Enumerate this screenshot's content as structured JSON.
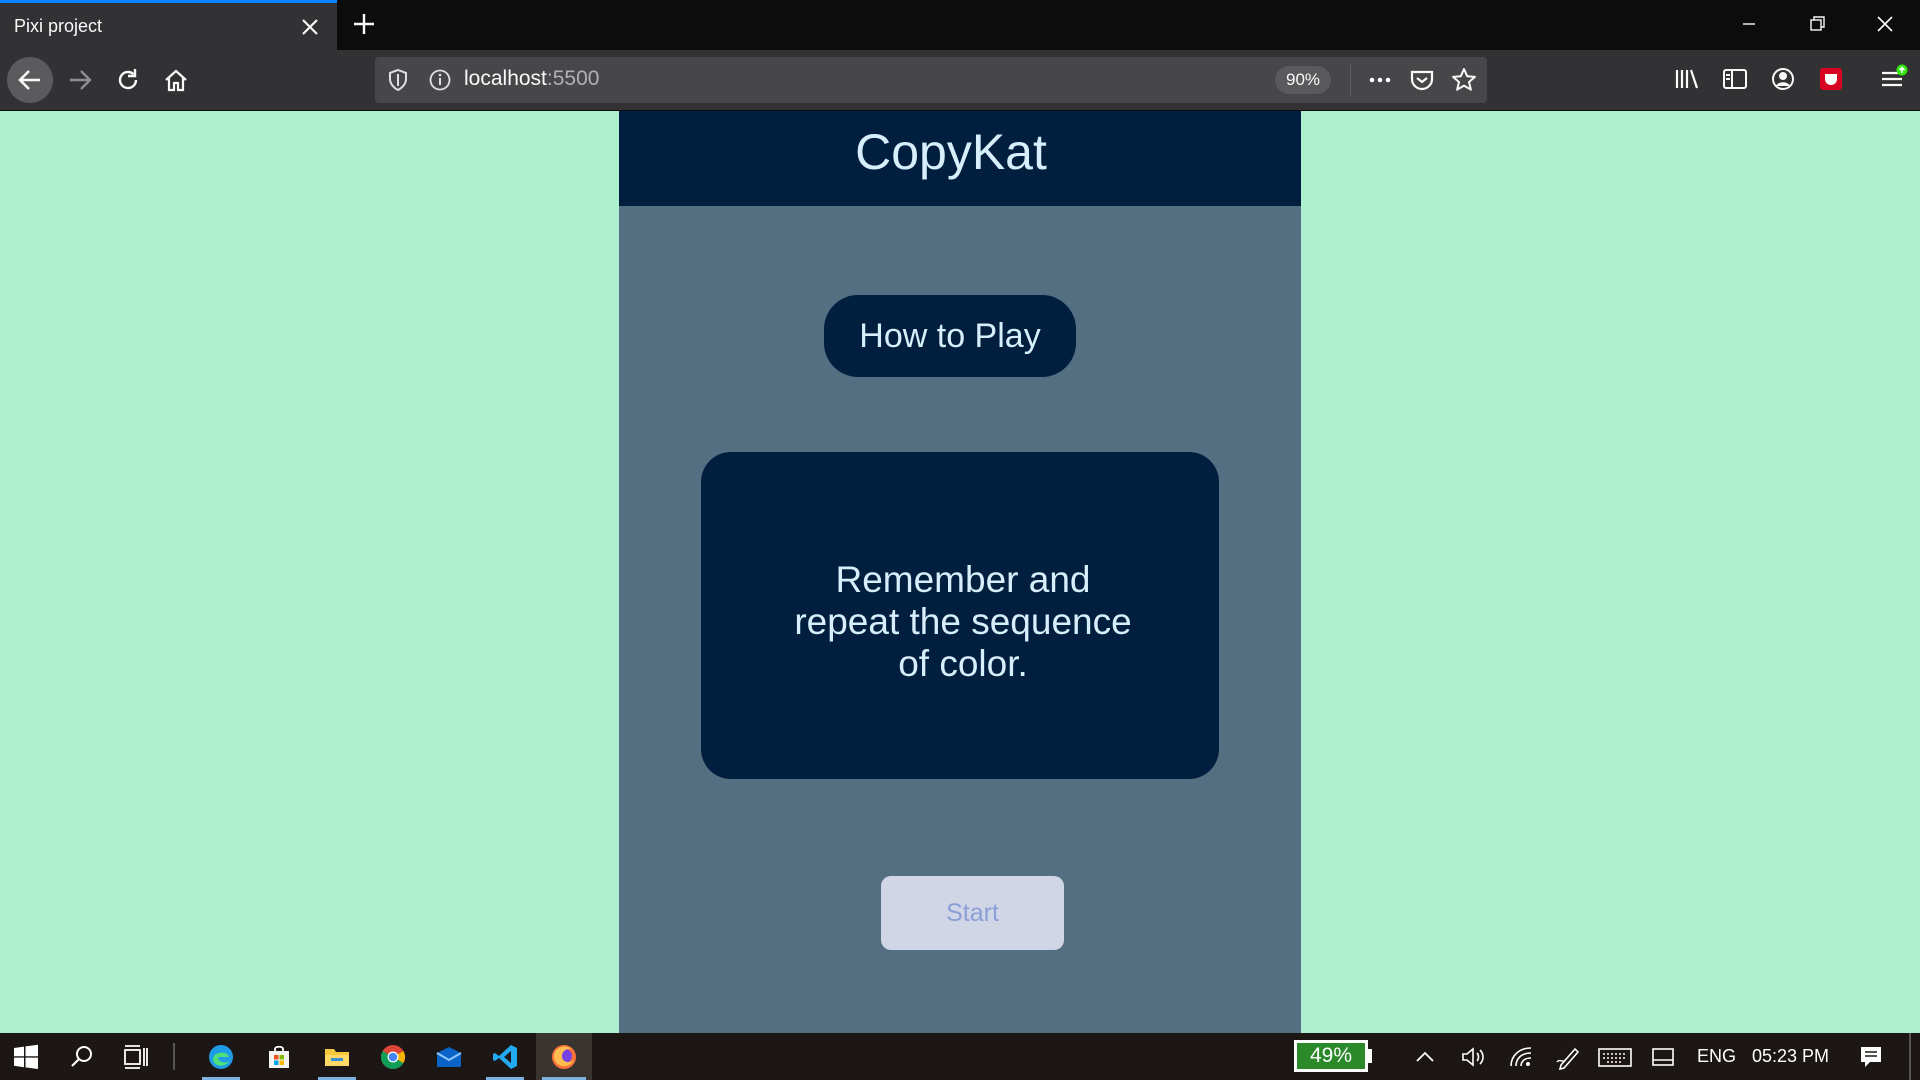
{
  "browser": {
    "tab_title": "Pixi project",
    "url_host": "localhost",
    "url_port": ":5500",
    "zoom": "90%"
  },
  "page": {
    "title": "CopyKat",
    "how_to_play_label": "How to Play",
    "rules_text": "Remember and repeat the sequence of color.",
    "start_label": "Start"
  },
  "taskbar": {
    "battery_percent": "49%",
    "language": "ENG",
    "time": "05:23 PM"
  },
  "colors": {
    "page_background": "#aef0d0",
    "game_background": "#536f81",
    "panel_navy": "#001f3e",
    "panel_text": "#d7eefc",
    "start_button_bg": "#d0d6e6",
    "start_button_text": "#8c9ed8",
    "tab_accent": "#0a84ff"
  }
}
